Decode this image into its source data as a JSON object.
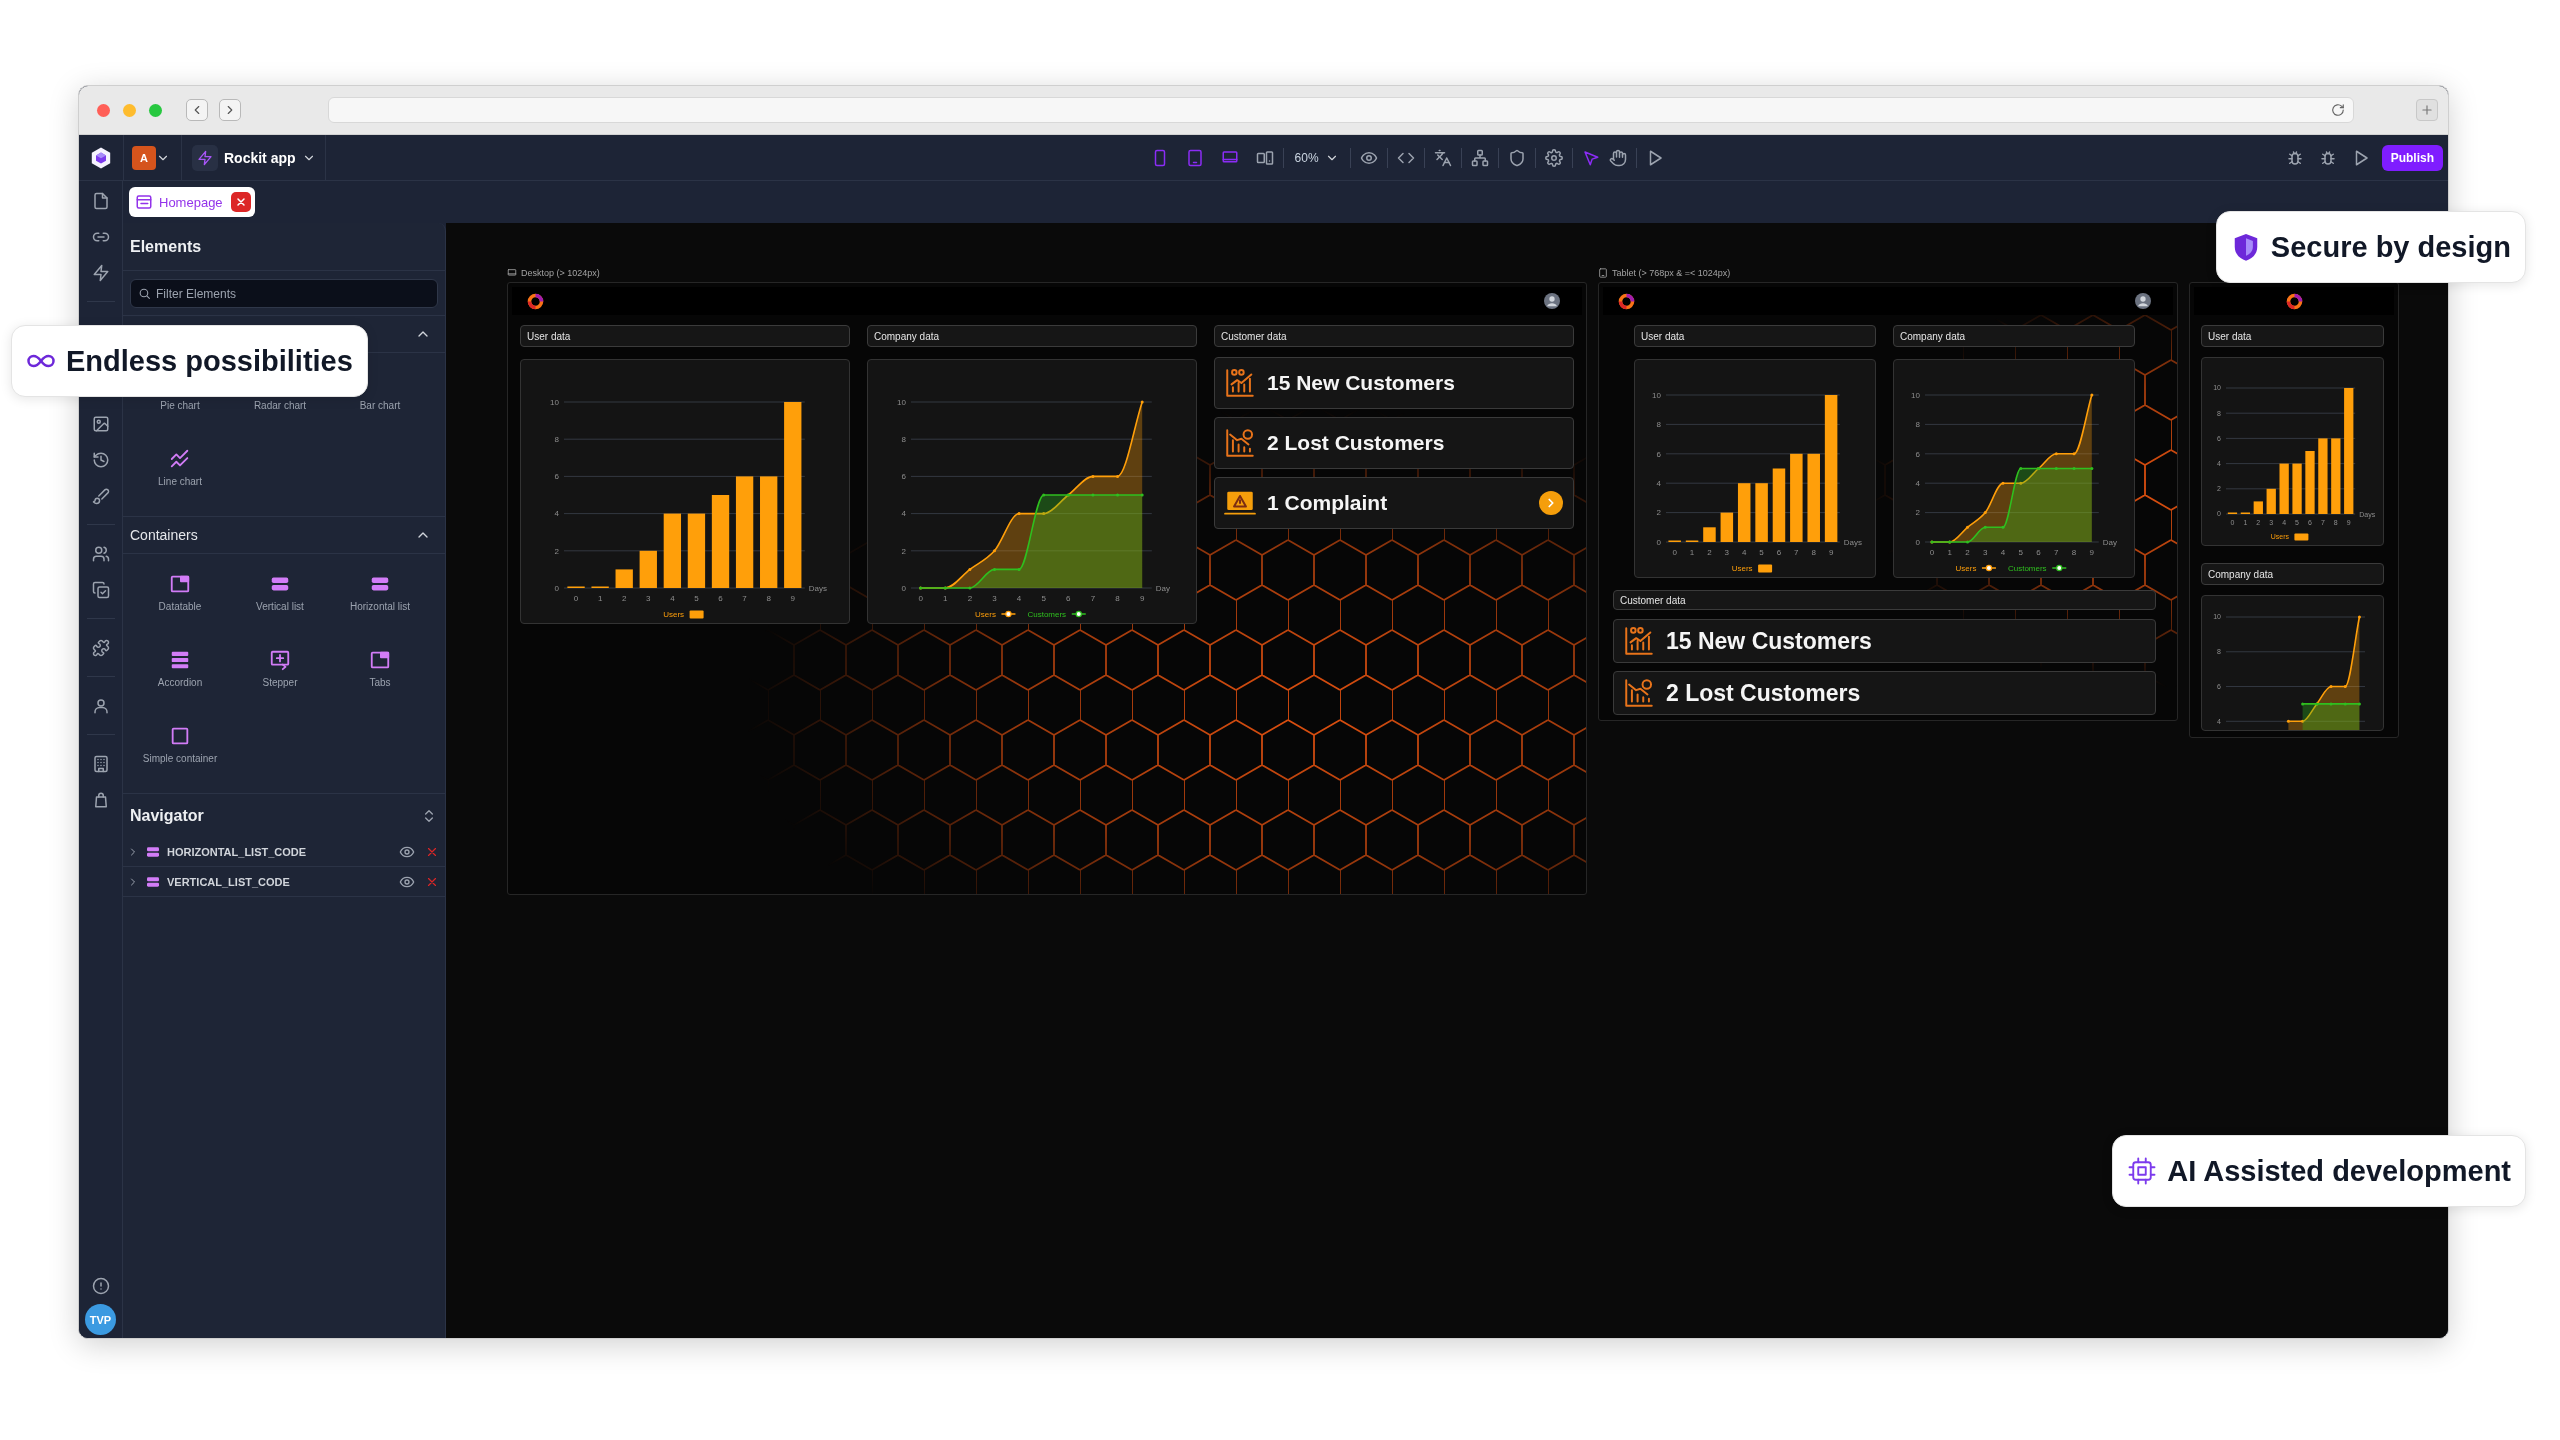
{
  "callouts": [
    {
      "kind": "secure",
      "text": "Secure by design"
    },
    {
      "kind": "endless",
      "text": "Endless possibilities"
    },
    {
      "kind": "ai",
      "text": "AI Assisted development"
    }
  ],
  "toolbar": {
    "workspace": "A",
    "project": "Rockit app",
    "devices": [
      {
        "kind": "phone",
        "on": true
      },
      {
        "kind": "tablet",
        "on": true
      },
      {
        "kind": "laptop",
        "on": true
      },
      {
        "kind": "responsive",
        "on": false
      }
    ],
    "zoom": "60%",
    "tools": [
      {
        "kind": "pointer",
        "selected": true
      },
      {
        "kind": "hand",
        "selected": false
      }
    ],
    "publish": "Publish"
  },
  "tabs": [
    {
      "label": "Homepage",
      "selected": true
    }
  ],
  "elements": {
    "title": "Elements",
    "search": {
      "placeholder": "Filter Elements"
    },
    "sections": [
      {
        "expanded": true,
        "items": [
          {
            "label": "Pie chart"
          },
          {
            "label": "Radar chart"
          },
          {
            "label": "Bar chart"
          },
          {
            "label": "Line chart",
            "kind": "line-chart"
          }
        ]
      },
      {
        "title": "Containers",
        "expanded": true,
        "items": [
          {
            "label": "Datatable",
            "kind": "window"
          },
          {
            "label": "Vertical list",
            "kind": "list"
          },
          {
            "label": "Horizontal list",
            "kind": "list"
          },
          {
            "label": "Accordion",
            "kind": "accordion"
          },
          {
            "label": "Stepper",
            "kind": "stepper"
          },
          {
            "label": "Tabs",
            "kind": "window"
          },
          {
            "label": "Simple container",
            "kind": "square"
          }
        ]
      }
    ]
  },
  "navigator": {
    "title": "Navigator",
    "items": [
      {
        "label": "HORIZONTAL_LIST_CODE",
        "expanded": false
      },
      {
        "label": "VERTICAL_LIST_CODE",
        "expanded": false
      }
    ]
  },
  "user": {
    "initials": "TVP"
  },
  "frames": [
    {
      "kind": "desktop",
      "label": "Desktop (> 1024px)",
      "sections": [
        {
          "kind": "chart",
          "title": "User data",
          "chart_data": {
            "type": "bar",
            "xlabel": "Days",
            "categories": [
              "0",
              "1",
              "2",
              "3",
              "4",
              "5",
              "6",
              "7",
              "8",
              "9"
            ],
            "ylim": [
              0,
              10
            ],
            "yticks": [
              0,
              2,
              4,
              6,
              8,
              10
            ],
            "grid": true,
            "legend": "bottom",
            "series": [
              {
                "name": "Users",
                "color": "#ff9f0a",
                "values": [
                  0,
                  0,
                  1,
                  2,
                  4,
                  4,
                  5,
                  6,
                  6,
                  10
                ]
              }
            ]
          }
        },
        {
          "kind": "chart",
          "title": "Company data",
          "chart_data": {
            "type": "area",
            "xlabel": "Day",
            "categories": [
              "0",
              "1",
              "2",
              "3",
              "4",
              "5",
              "6",
              "7",
              "8",
              "9"
            ],
            "ylim": [
              0,
              10
            ],
            "yticks": [
              0,
              2,
              4,
              6,
              8,
              10
            ],
            "grid": true,
            "legend": "bottom",
            "series": [
              {
                "name": "Users",
                "color": "#ff9f0a",
                "values": [
                  0,
                  0,
                  1,
                  2,
                  4,
                  4,
                  5,
                  6,
                  6,
                  10
                ]
              },
              {
                "name": "Customers",
                "color": "#2fbf1f",
                "values": [
                  0,
                  0,
                  0,
                  1,
                  1,
                  5,
                  5,
                  5,
                  5,
                  5
                ]
              }
            ]
          }
        },
        {
          "kind": "stats",
          "title": "Customer data",
          "stats": [
            {
              "kind": "new",
              "text": "15 New Customers",
              "action": false
            },
            {
              "kind": "lost",
              "text": "2 Lost Customers",
              "action": false
            },
            {
              "kind": "complaint",
              "text": "1 Complaint",
              "action": true
            }
          ]
        }
      ]
    },
    {
      "kind": "tablet",
      "label": "Tablet (> 768px & =< 1024px)",
      "sections": [
        {
          "kind": "chart",
          "title": "User data",
          "chart_data": {
            "type": "bar",
            "xlabel": "Days",
            "categories": [
              "0",
              "1",
              "2",
              "3",
              "4",
              "5",
              "6",
              "7",
              "8",
              "9"
            ],
            "ylim": [
              0,
              10
            ],
            "yticks": [
              0,
              2,
              4,
              6,
              8,
              10
            ],
            "grid": true,
            "legend": "bottom",
            "series": [
              {
                "name": "Users",
                "color": "#ff9f0a",
                "values": [
                  0,
                  0,
                  1,
                  2,
                  4,
                  4,
                  5,
                  6,
                  6,
                  10
                ]
              }
            ]
          }
        },
        {
          "kind": "chart",
          "title": "Company data",
          "chart_data": {
            "type": "area",
            "xlabel": "Day",
            "categories": [
              "0",
              "1",
              "2",
              "3",
              "4",
              "5",
              "6",
              "7",
              "8",
              "9"
            ],
            "ylim": [
              0,
              10
            ],
            "yticks": [
              0,
              2,
              4,
              6,
              8,
              10
            ],
            "grid": true,
            "legend": "bottom",
            "series": [
              {
                "name": "Users",
                "color": "#ff9f0a",
                "values": [
                  0,
                  0,
                  1,
                  2,
                  4,
                  4,
                  5,
                  6,
                  6,
                  10
                ]
              },
              {
                "name": "Customers",
                "color": "#2fbf1f",
                "values": [
                  0,
                  0,
                  0,
                  1,
                  1,
                  5,
                  5,
                  5,
                  5,
                  5
                ]
              }
            ]
          }
        },
        {
          "kind": "stats",
          "title": "Customer data",
          "stats": [
            {
              "kind": "new",
              "text": "15 New Customers",
              "action": false
            },
            {
              "kind": "lost",
              "text": "2 Lost Customers",
              "action": false
            }
          ]
        }
      ]
    },
    {
      "kind": "mobile",
      "sections": [
        {
          "kind": "chart",
          "title": "User data",
          "chart_data": {
            "type": "bar",
            "xlabel": "Days",
            "categories": [
              "0",
              "1",
              "2",
              "3",
              "4",
              "5",
              "6",
              "7",
              "8",
              "9"
            ],
            "ylim": [
              0,
              10
            ],
            "yticks": [
              0,
              2,
              4,
              6,
              8,
              10
            ],
            "grid": true,
            "legend": "bottom",
            "series": [
              {
                "name": "Users",
                "color": "#ff9f0a",
                "values": [
                  0,
                  0,
                  1,
                  2,
                  4,
                  4,
                  5,
                  6,
                  6,
                  10
                ]
              }
            ]
          }
        },
        {
          "kind": "chart",
          "title": "Company data",
          "chart_data": {
            "type": "area",
            "ylim": [
              3.5,
              10
            ],
            "yticks": [
              4,
              6,
              8,
              10
            ],
            "grid": true,
            "series": [
              {
                "color": "#ff9f0a",
                "values": [
                  null,
                  null,
                  null,
                  null,
                  4,
                  4,
                  5,
                  6,
                  6,
                  10
                ]
              },
              {
                "color": "#2fbf1f",
                "values": [
                  null,
                  null,
                  null,
                  null,
                  null,
                  5,
                  5,
                  5,
                  5,
                  5
                ]
              }
            ]
          }
        }
      ]
    }
  ]
}
